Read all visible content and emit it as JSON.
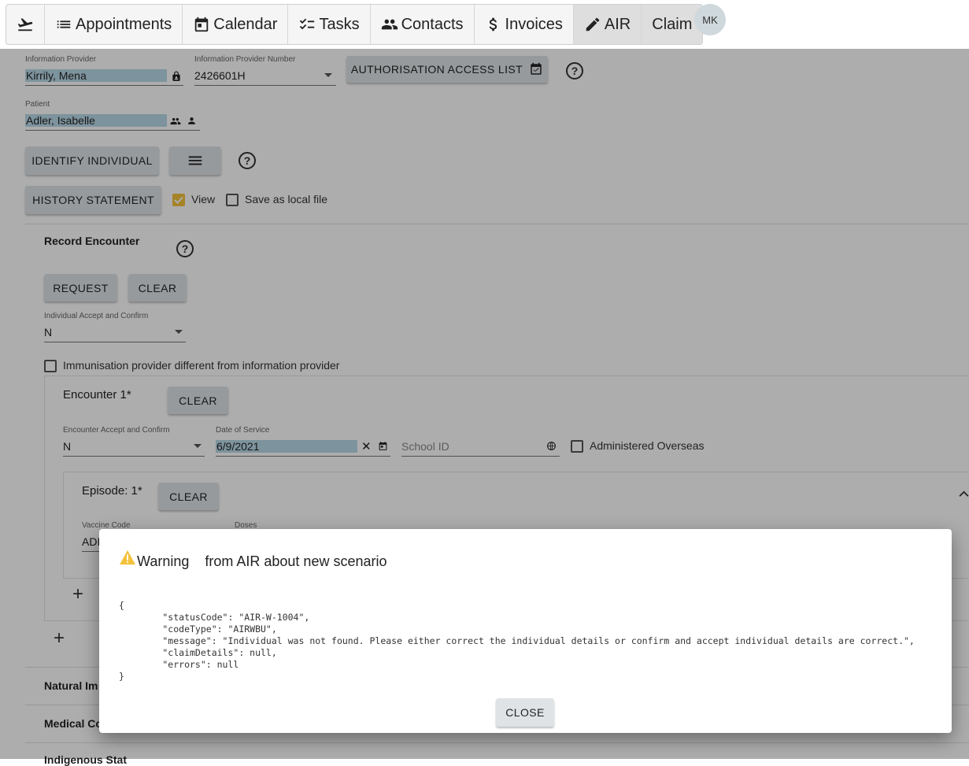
{
  "nav": {
    "items": [
      {
        "icon": "departure-icon",
        "label": ""
      },
      {
        "icon": "list-icon",
        "label": "Appointments"
      },
      {
        "icon": "calendar-icon",
        "label": "Calendar"
      },
      {
        "icon": "tasks-icon",
        "label": "Tasks"
      },
      {
        "icon": "contacts-icon",
        "label": "Contacts"
      },
      {
        "icon": "dollar-icon",
        "label": "Invoices"
      },
      {
        "icon": "pencil-icon",
        "label": "AIR"
      },
      {
        "icon": "",
        "label": "Claim"
      }
    ],
    "active": "AIR",
    "avatar": "MK"
  },
  "provider": {
    "label": "Information Provider",
    "value": "Kirrily, Mena",
    "number_label": "Information Provider Number",
    "number_value": "2426601H",
    "auth_button": "AUTHORISATION ACCESS LIST"
  },
  "patient": {
    "label": "Patient",
    "value": "Adler, Isabelle"
  },
  "actions": {
    "identify": "IDENTIFY INDIVIDUAL",
    "history": "HISTORY STATEMENT",
    "view_label": "View",
    "save_local_label": "Save as local file"
  },
  "record": {
    "title": "Record Encounter",
    "request": "REQUEST",
    "clear": "CLEAR",
    "accept_label": "Individual Accept and Confirm",
    "accept_value": "N",
    "immunisation_diff": "Immunisation provider different from information provider"
  },
  "encounter": {
    "title": "Encounter 1*",
    "clear": "CLEAR",
    "accept_label": "Encounter Accept and Confirm",
    "accept_value": "N",
    "date_label": "Date of Service",
    "date_value": "6/9/2021",
    "school_placeholder": "School ID",
    "overseas_label": "Administered Overseas"
  },
  "episode": {
    "title": "Episode: 1*",
    "clear": "CLEAR",
    "vaccine_label": "Vaccine Code",
    "vaccine_value": "ADI",
    "doses_label": "Doses"
  },
  "sections": {
    "natural": "Natural Im",
    "medical": "Medical Co",
    "indigenous": "Indigenous Stat"
  },
  "dialog": {
    "warning": "Warning",
    "title_rest": "from AIR about new scenario",
    "body": "{\n        \"statusCode\": \"AIR-W-1004\",\n        \"codeType\": \"AIRWBU\",\n        \"message\": \"Individual was not found. Please either correct the individual details or confirm and accept individual details are correct.\",\n        \"claimDetails\": null,\n        \"errors\": null\n}",
    "close": "CLOSE"
  },
  "colors": {
    "highlight": "#b9d9e8",
    "accent": "#f3c23c",
    "button_bg": "#dfe3e6"
  }
}
